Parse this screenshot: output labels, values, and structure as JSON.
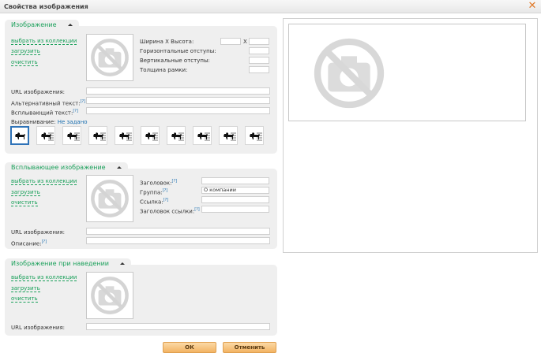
{
  "dialog": {
    "title": "Свойства изображения",
    "close_icon": "close-icon"
  },
  "image": {
    "section_title": "Изображение",
    "links": [
      "выбрать из коллекции",
      "загрузить",
      "очистить"
    ],
    "size_label": "Ширина Х Высота:",
    "x_sep": "X",
    "hspace_label": "Горизонтальные отступы:",
    "vspace_label": "Вертикальные отступы:",
    "border_label": "Толщина рамки:",
    "url_label": "URL изображения:",
    "alt_label": "Альтернативный текст:",
    "title_label": "Всплывающий текст:",
    "help": "[?]",
    "align_label": "Выравнивание:",
    "align_value": "Не задано",
    "align_count": 10
  },
  "popup": {
    "section_title": "Всплывающее изображение",
    "links": [
      "выбрать из коллекции",
      "загрузить",
      "очистить"
    ],
    "header_label": "Заголовок:",
    "group_label": "Группа:",
    "group_value": "О компании",
    "link_label": "Ссылка:",
    "link_title_label": "Заголовок ссылки:",
    "url_label": "URL изображения:",
    "desc_label": "Описание:",
    "help": "[?]"
  },
  "hover": {
    "section_title": "Изображение при наведении",
    "links": [
      "выбрать из коллекции",
      "загрузить",
      "очистить"
    ],
    "url_label": "URL изображения:"
  },
  "buttons": {
    "ok": "ОК",
    "cancel": "Отменить"
  },
  "colors": {
    "accent": "#1aa05a",
    "button": "#f3b363",
    "close": "#e07a2a"
  }
}
